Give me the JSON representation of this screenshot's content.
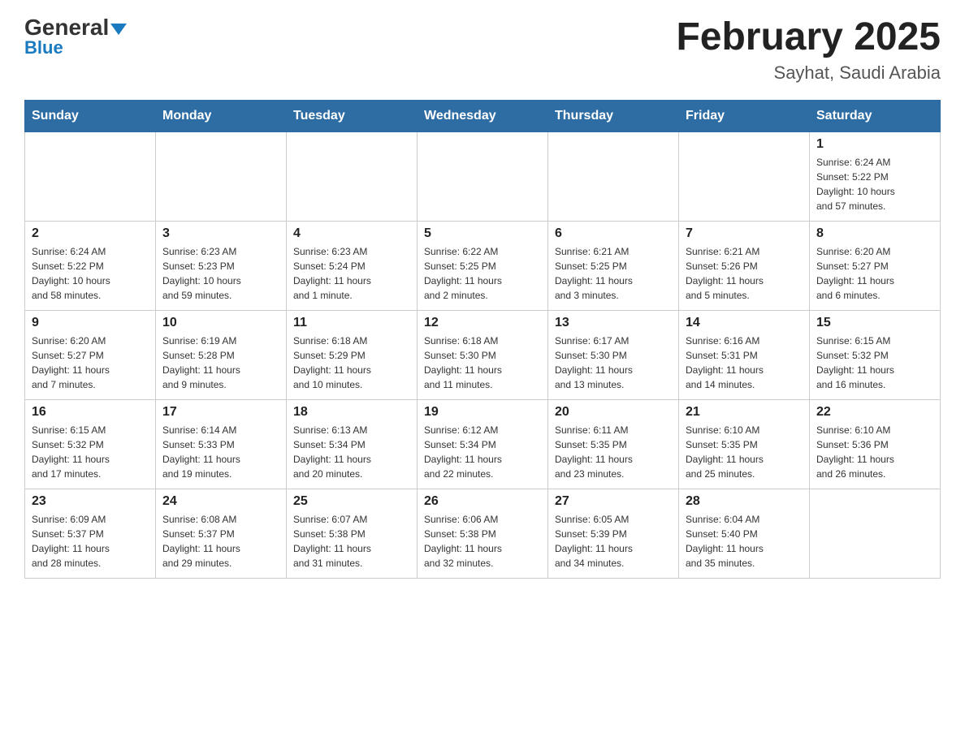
{
  "header": {
    "logo_general": "General",
    "logo_blue": "Blue",
    "month_title": "February 2025",
    "location": "Sayhat, Saudi Arabia"
  },
  "days_of_week": [
    "Sunday",
    "Monday",
    "Tuesday",
    "Wednesday",
    "Thursday",
    "Friday",
    "Saturday"
  ],
  "weeks": [
    [
      {
        "day": "",
        "info": ""
      },
      {
        "day": "",
        "info": ""
      },
      {
        "day": "",
        "info": ""
      },
      {
        "day": "",
        "info": ""
      },
      {
        "day": "",
        "info": ""
      },
      {
        "day": "",
        "info": ""
      },
      {
        "day": "1",
        "info": "Sunrise: 6:24 AM\nSunset: 5:22 PM\nDaylight: 10 hours\nand 57 minutes."
      }
    ],
    [
      {
        "day": "2",
        "info": "Sunrise: 6:24 AM\nSunset: 5:22 PM\nDaylight: 10 hours\nand 58 minutes."
      },
      {
        "day": "3",
        "info": "Sunrise: 6:23 AM\nSunset: 5:23 PM\nDaylight: 10 hours\nand 59 minutes."
      },
      {
        "day": "4",
        "info": "Sunrise: 6:23 AM\nSunset: 5:24 PM\nDaylight: 11 hours\nand 1 minute."
      },
      {
        "day": "5",
        "info": "Sunrise: 6:22 AM\nSunset: 5:25 PM\nDaylight: 11 hours\nand 2 minutes."
      },
      {
        "day": "6",
        "info": "Sunrise: 6:21 AM\nSunset: 5:25 PM\nDaylight: 11 hours\nand 3 minutes."
      },
      {
        "day": "7",
        "info": "Sunrise: 6:21 AM\nSunset: 5:26 PM\nDaylight: 11 hours\nand 5 minutes."
      },
      {
        "day": "8",
        "info": "Sunrise: 6:20 AM\nSunset: 5:27 PM\nDaylight: 11 hours\nand 6 minutes."
      }
    ],
    [
      {
        "day": "9",
        "info": "Sunrise: 6:20 AM\nSunset: 5:27 PM\nDaylight: 11 hours\nand 7 minutes."
      },
      {
        "day": "10",
        "info": "Sunrise: 6:19 AM\nSunset: 5:28 PM\nDaylight: 11 hours\nand 9 minutes."
      },
      {
        "day": "11",
        "info": "Sunrise: 6:18 AM\nSunset: 5:29 PM\nDaylight: 11 hours\nand 10 minutes."
      },
      {
        "day": "12",
        "info": "Sunrise: 6:18 AM\nSunset: 5:30 PM\nDaylight: 11 hours\nand 11 minutes."
      },
      {
        "day": "13",
        "info": "Sunrise: 6:17 AM\nSunset: 5:30 PM\nDaylight: 11 hours\nand 13 minutes."
      },
      {
        "day": "14",
        "info": "Sunrise: 6:16 AM\nSunset: 5:31 PM\nDaylight: 11 hours\nand 14 minutes."
      },
      {
        "day": "15",
        "info": "Sunrise: 6:15 AM\nSunset: 5:32 PM\nDaylight: 11 hours\nand 16 minutes."
      }
    ],
    [
      {
        "day": "16",
        "info": "Sunrise: 6:15 AM\nSunset: 5:32 PM\nDaylight: 11 hours\nand 17 minutes."
      },
      {
        "day": "17",
        "info": "Sunrise: 6:14 AM\nSunset: 5:33 PM\nDaylight: 11 hours\nand 19 minutes."
      },
      {
        "day": "18",
        "info": "Sunrise: 6:13 AM\nSunset: 5:34 PM\nDaylight: 11 hours\nand 20 minutes."
      },
      {
        "day": "19",
        "info": "Sunrise: 6:12 AM\nSunset: 5:34 PM\nDaylight: 11 hours\nand 22 minutes."
      },
      {
        "day": "20",
        "info": "Sunrise: 6:11 AM\nSunset: 5:35 PM\nDaylight: 11 hours\nand 23 minutes."
      },
      {
        "day": "21",
        "info": "Sunrise: 6:10 AM\nSunset: 5:35 PM\nDaylight: 11 hours\nand 25 minutes."
      },
      {
        "day": "22",
        "info": "Sunrise: 6:10 AM\nSunset: 5:36 PM\nDaylight: 11 hours\nand 26 minutes."
      }
    ],
    [
      {
        "day": "23",
        "info": "Sunrise: 6:09 AM\nSunset: 5:37 PM\nDaylight: 11 hours\nand 28 minutes."
      },
      {
        "day": "24",
        "info": "Sunrise: 6:08 AM\nSunset: 5:37 PM\nDaylight: 11 hours\nand 29 minutes."
      },
      {
        "day": "25",
        "info": "Sunrise: 6:07 AM\nSunset: 5:38 PM\nDaylight: 11 hours\nand 31 minutes."
      },
      {
        "day": "26",
        "info": "Sunrise: 6:06 AM\nSunset: 5:38 PM\nDaylight: 11 hours\nand 32 minutes."
      },
      {
        "day": "27",
        "info": "Sunrise: 6:05 AM\nSunset: 5:39 PM\nDaylight: 11 hours\nand 34 minutes."
      },
      {
        "day": "28",
        "info": "Sunrise: 6:04 AM\nSunset: 5:40 PM\nDaylight: 11 hours\nand 35 minutes."
      },
      {
        "day": "",
        "info": ""
      }
    ]
  ]
}
